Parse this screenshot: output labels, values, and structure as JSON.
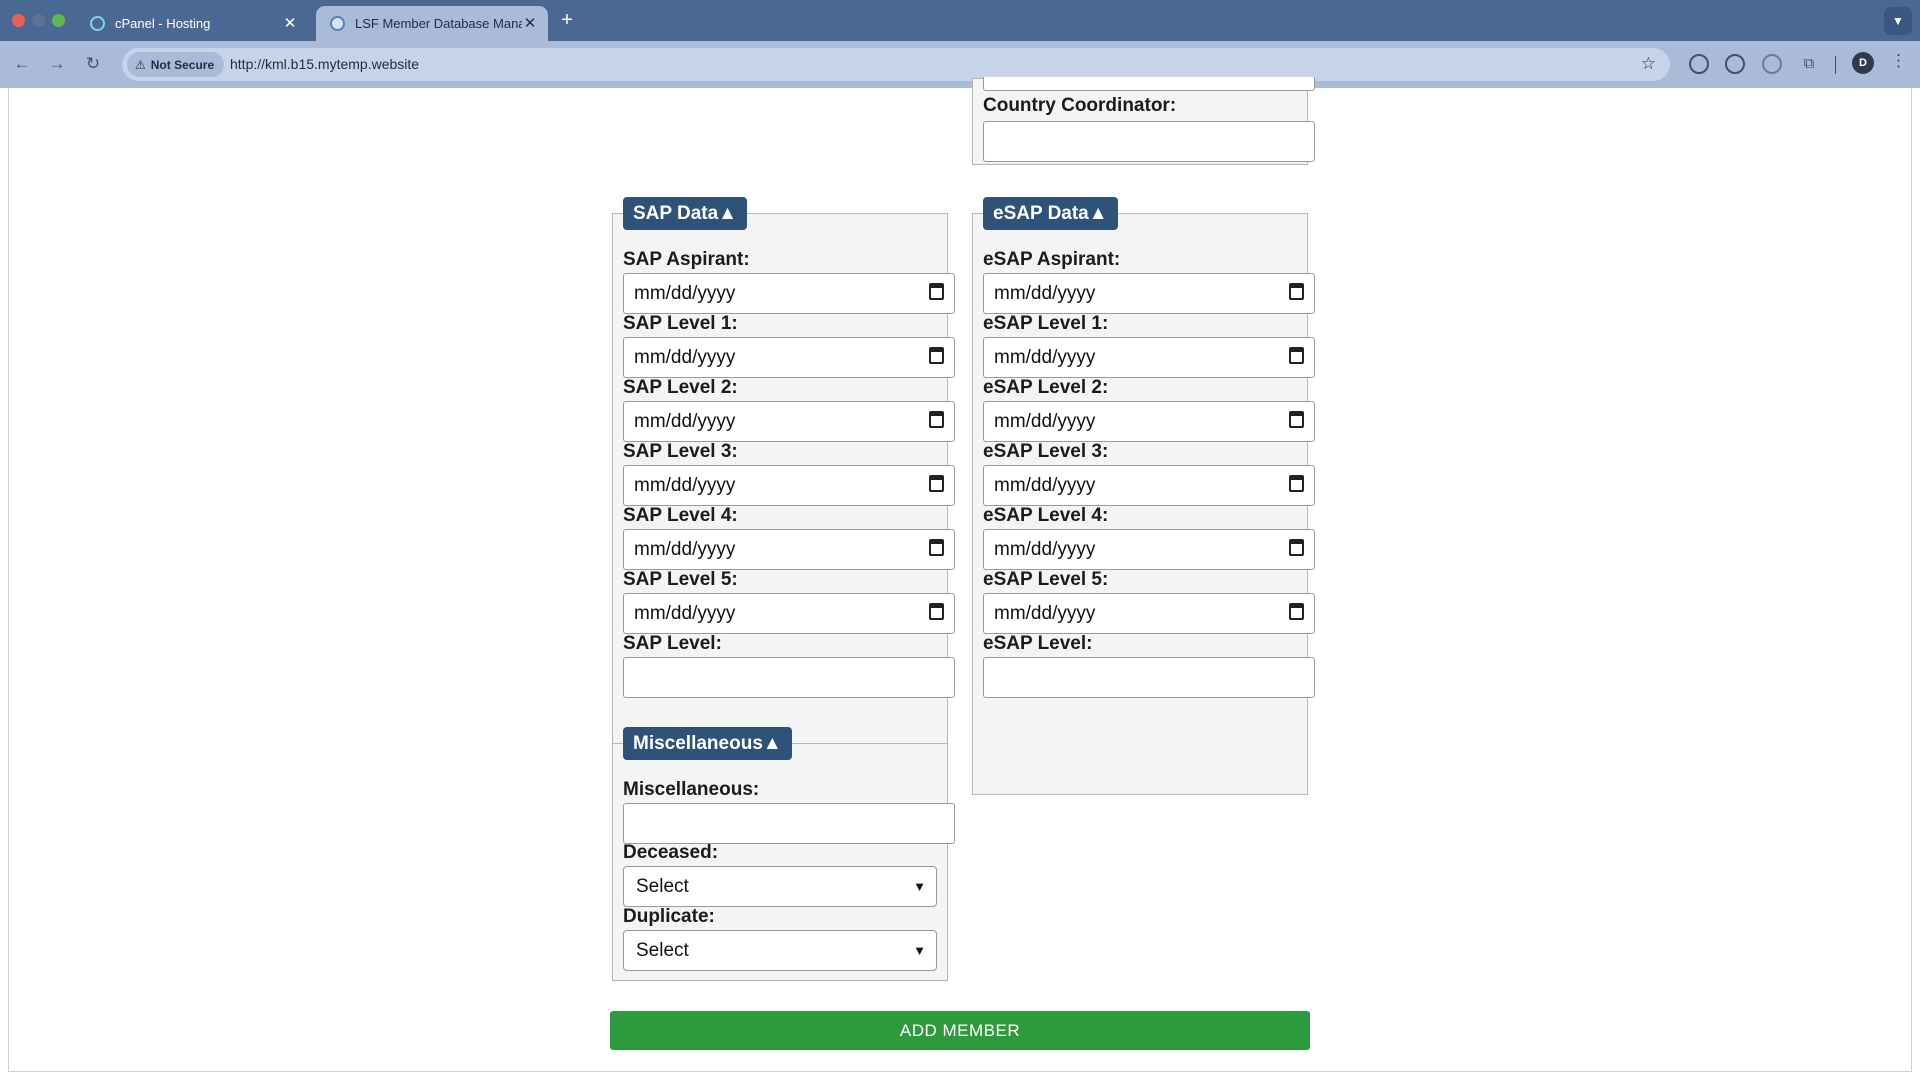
{
  "browser": {
    "tabs": [
      {
        "title": "cPanel - Hosting",
        "active": false
      },
      {
        "title": "LSF Member Database Manag",
        "active": true
      }
    ],
    "new_tab": "+",
    "security_label": "Not Secure",
    "url": "http://kml.b15.mytemp.website",
    "profile_initial": "D"
  },
  "form": {
    "partial_section": {
      "label": "Country Coordinator:",
      "value": ""
    },
    "sap": {
      "legend": "SAP Data▲",
      "fields": [
        {
          "label": "SAP Aspirant:",
          "value": "mm/dd/yyyy"
        },
        {
          "label": "SAP Level 1:",
          "value": "mm/dd/yyyy"
        },
        {
          "label": "SAP Level 2:",
          "value": "mm/dd/yyyy"
        },
        {
          "label": "SAP Level 3:",
          "value": "mm/dd/yyyy"
        },
        {
          "label": "SAP Level 4:",
          "value": "mm/dd/yyyy"
        },
        {
          "label": "SAP Level 5:",
          "value": "mm/dd/yyyy"
        },
        {
          "label": "SAP Level:",
          "value": ""
        }
      ]
    },
    "esap": {
      "legend": "eSAP Data▲",
      "fields": [
        {
          "label": "eSAP Aspirant:",
          "value": "mm/dd/yyyy"
        },
        {
          "label": "eSAP Level 1:",
          "value": "mm/dd/yyyy"
        },
        {
          "label": "eSAP Level 2:",
          "value": "mm/dd/yyyy"
        },
        {
          "label": "eSAP Level 3:",
          "value": "mm/dd/yyyy"
        },
        {
          "label": "eSAP Level 4:",
          "value": "mm/dd/yyyy"
        },
        {
          "label": "eSAP Level 5:",
          "value": "mm/dd/yyyy"
        },
        {
          "label": "eSAP Level:",
          "value": ""
        }
      ]
    },
    "misc": {
      "legend": "Miscellaneous▲",
      "misc_label": "Miscellaneous:",
      "misc_value": "",
      "deceased_label": "Deceased:",
      "deceased_value": "Select",
      "duplicate_label": "Duplicate:",
      "duplicate_value": "Select"
    },
    "submit_label": "ADD MEMBER"
  },
  "colors": {
    "tabbar": "#4a6894",
    "toolbar": "#a9bbd9",
    "legend_bg": "#2f5279",
    "submit_bg": "#2e9a3e"
  }
}
